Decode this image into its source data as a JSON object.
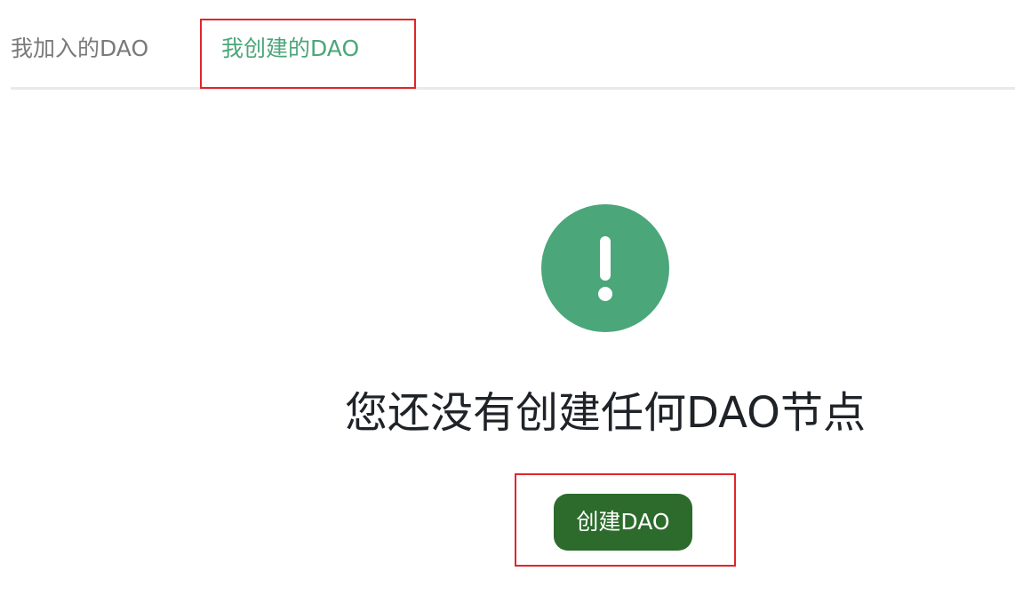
{
  "tabs": {
    "items": [
      {
        "label": "我加入的DAO",
        "active": false
      },
      {
        "label": "我创建的DAO",
        "active": true
      }
    ]
  },
  "empty_state": {
    "icon": "exclamation-circle-icon",
    "message": "您还没有创建任何DAO节点",
    "button_label": "创建DAO"
  },
  "colors": {
    "accent": "#4ba679",
    "button_bg": "#2c6b2c",
    "inactive_tab_text": "#7a7a7a",
    "annotation_border": "#e0262a"
  }
}
